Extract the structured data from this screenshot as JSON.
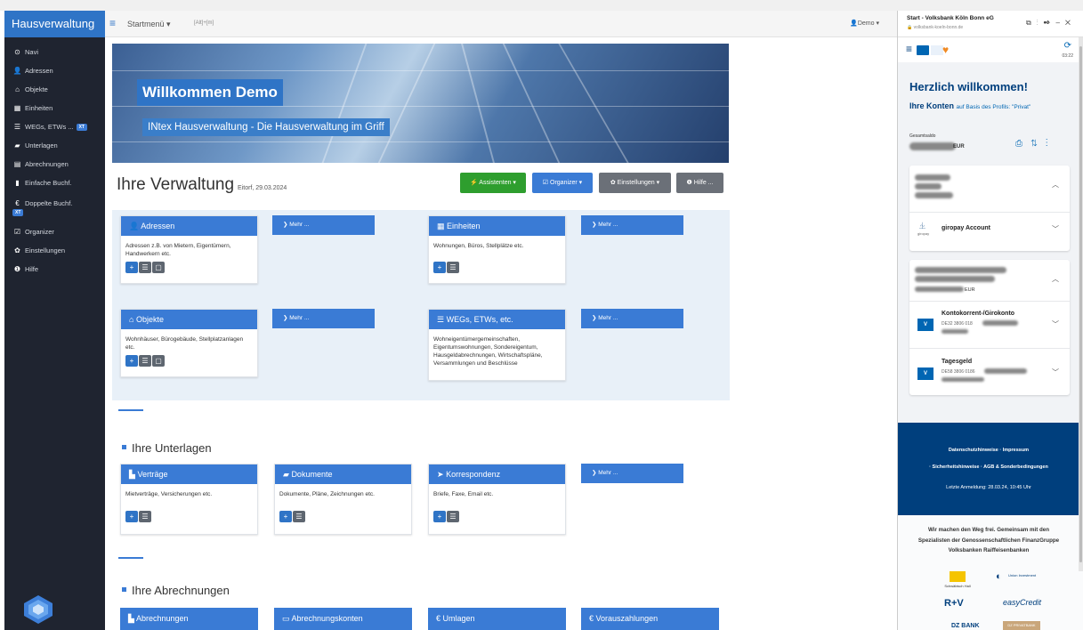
{
  "sidebar": {
    "brand": "Hausverwaltung",
    "items": [
      {
        "icon": "navi-icon",
        "label": "Navi"
      },
      {
        "icon": "user-icon",
        "label": "Adressen"
      },
      {
        "icon": "home-icon",
        "label": "Objekte"
      },
      {
        "icon": "grid-icon",
        "label": "Einheiten"
      },
      {
        "icon": "list-icon",
        "label": "WEGs, ETWs ...",
        "badge": "XT"
      },
      {
        "icon": "folder-icon",
        "label": "Unterlagen"
      },
      {
        "icon": "calc-icon",
        "label": "Abrechnungen"
      },
      {
        "icon": "book-icon",
        "label": "Einfache Buchf."
      },
      {
        "icon": "euro-icon",
        "label": "Doppelte Buchf.",
        "badge": "XT"
      },
      {
        "icon": "edit-icon",
        "label": "Organizer"
      },
      {
        "icon": "gear-icon",
        "label": "Einstellungen"
      },
      {
        "icon": "help-icon",
        "label": "Hilfe"
      }
    ]
  },
  "topbar": {
    "menu": "Startmenü ▾",
    "shortcut": "[Alt]+[m]",
    "user": "Demo ▾"
  },
  "banner": {
    "welcome": "Willkommen Demo",
    "subtitle": "INtex Hausverwaltung - Die Hausverwaltung im Griff"
  },
  "main": {
    "title": "Ihre Verwaltung",
    "location_date": "Eitorf, 29.03.2024",
    "buttons": {
      "assistenten": "⚡ Assistenten ▾",
      "organizer": "☑ Organizer ▾",
      "einstellungen": "✿ Einstellungen ▾",
      "hilfe": "❶ Hilfe ..."
    },
    "more_label": "❯  Mehr ...",
    "cards": {
      "adressen": {
        "title": "Adressen",
        "text": "Adressen z.B. von Mietern, Eigentümern, Handwerkern etc."
      },
      "einheiten": {
        "title": "Einheiten",
        "text": "Wohnungen, Büros, Stellplätze etc."
      },
      "objekte": {
        "title": "Objekte",
        "text": "Wohnhäuser, Bürogebäude, Stellplatzanlagen etc."
      },
      "wegs": {
        "title": "WEGs, ETWs, etc.",
        "text": "Wohneigentümergemeinschaften, Eigentumswohnungen, Sondereigentum, Hausgeldabrechnungen, Wirtschaftspläne, Versammlungen und Beschlüsse"
      }
    },
    "unterlagen": {
      "title": "Ihre Unterlagen",
      "cards": {
        "vertraege": {
          "title": "Verträge",
          "text": "Mietverträge, Versicherungen etc."
        },
        "dokumente": {
          "title": "Dokumente",
          "text": "Dokumente, Pläne, Zeichnungen etc."
        },
        "korrespondenz": {
          "title": "Korrespondenz",
          "text": "Briefe, Faxe, Email etc."
        }
      }
    },
    "abrechnungen": {
      "title": "Ihre Abrechnungen",
      "cards": {
        "abrechnungen": "Abrechnungen",
        "konten": "Abrechnungskonten",
        "umlagen": "Umlagen",
        "vorauszahlungen": "Vorauszahlungen"
      }
    }
  },
  "bank": {
    "window_title": "Start - Volksbank Köln Bonn eG",
    "url": "volksbank-koeln-bonn.de",
    "time": "03:22",
    "greeting": "Herzlich willkommen!",
    "konten": "Ihre Konten",
    "profile": "auf Basis des Profils: \"Privat\"",
    "gesamtsaldo": "Gesamtsaldo",
    "eur": "EUR",
    "giropay": "giropay Account",
    "giropay_small": "giropay",
    "accounts": [
      {
        "name": "Kontokorrent-/Girokonto",
        "iban": "DE32 3806 018"
      },
      {
        "name": "Tagesgeld",
        "iban": "DE58 3806 0186"
      }
    ],
    "footer": {
      "line1": "Datenschutzhinweise  ·  Impressum",
      "line2": "·  Sicherheitshinweise  ·  AGB & Sonderbedingungen",
      "line3": "Letzte Anmeldung: 28.03.24, 10:45 Uhr"
    },
    "slogan": [
      "Wir machen den Weg frei. Gemeinsam mit den",
      "Spezialisten der Genossenschaftlichen FinanzGruppe",
      "Volksbanken Raiffeisenbanken"
    ],
    "partners": {
      "sh": "Schwäbisch Hall",
      "ui": "Union Investment",
      "rv": "R+V",
      "ec": "easyCredit",
      "dz": "DZ BANK",
      "dzp": "DZ PRIVATBANK"
    }
  },
  "colors": {
    "accent": "#3a7bd5",
    "sidebar": "#1f2430",
    "bank_blue": "#003f7d",
    "green": "#2e9e2e",
    "grey": "#6b7078"
  }
}
